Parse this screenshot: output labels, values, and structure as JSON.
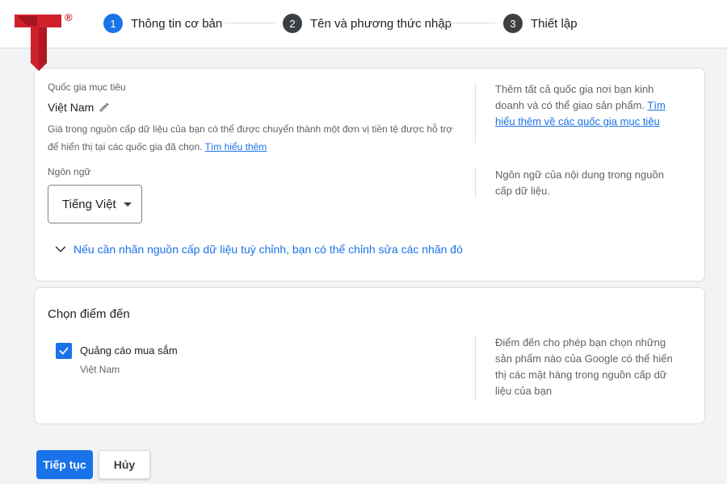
{
  "brand": {
    "registered_mark": "®",
    "color": "#d0202b"
  },
  "stepper": {
    "steps": [
      {
        "number": "1",
        "label": "Thông tin cơ bản",
        "state": "active"
      },
      {
        "number": "2",
        "label": "Tên và phương thức nhập",
        "state": "pending"
      },
      {
        "number": "3",
        "label": "Thiết lập",
        "state": "pending"
      }
    ]
  },
  "basic_info": {
    "country": {
      "label": "Quốc gia mục tiêu",
      "value": "Việt Nam",
      "icon": "pencil-icon",
      "description": "Giá trong nguồn cấp dữ liệu của bạn có thể được chuyển thành một đơn vị tiền tệ được hỗ trợ để hiển thị tại các quốc gia đã chọn.",
      "description_link": "Tìm hiểu thêm",
      "help_text": "Thêm tất cả quốc gia nơi bạn kinh doanh và có thể giao sản phẩm.",
      "help_link": "Tìm hiểu thêm về các quốc gia mục tiêu"
    },
    "language": {
      "label": "Ngôn ngữ",
      "selected": "Tiếng Việt",
      "help_text": "Ngôn ngữ của nội dung trong nguồn cấp dữ liệu."
    },
    "custom_labels": {
      "label": "Nếu cần nhãn nguồn cấp dữ liệu tuỳ chỉnh, bạn có thể chỉnh sửa các nhãn đó",
      "icon": "chevron-down-icon"
    }
  },
  "destinations": {
    "title": "Chọn điểm đến",
    "item": {
      "label": "Quảng cáo mua sắm",
      "sub": "Việt Nam",
      "checked": true
    },
    "help_text": "Điểm đến cho phép bạn chọn những sản phẩm nào của Google có thể hiển thị các mặt hàng trong nguồn cấp dữ liệu của bạn"
  },
  "actions": {
    "continue": "Tiếp tục",
    "cancel": "Hủy"
  },
  "colors": {
    "accent": "#1a73e8",
    "background": "#f1f3f4",
    "step_inactive": "#3c4043"
  }
}
